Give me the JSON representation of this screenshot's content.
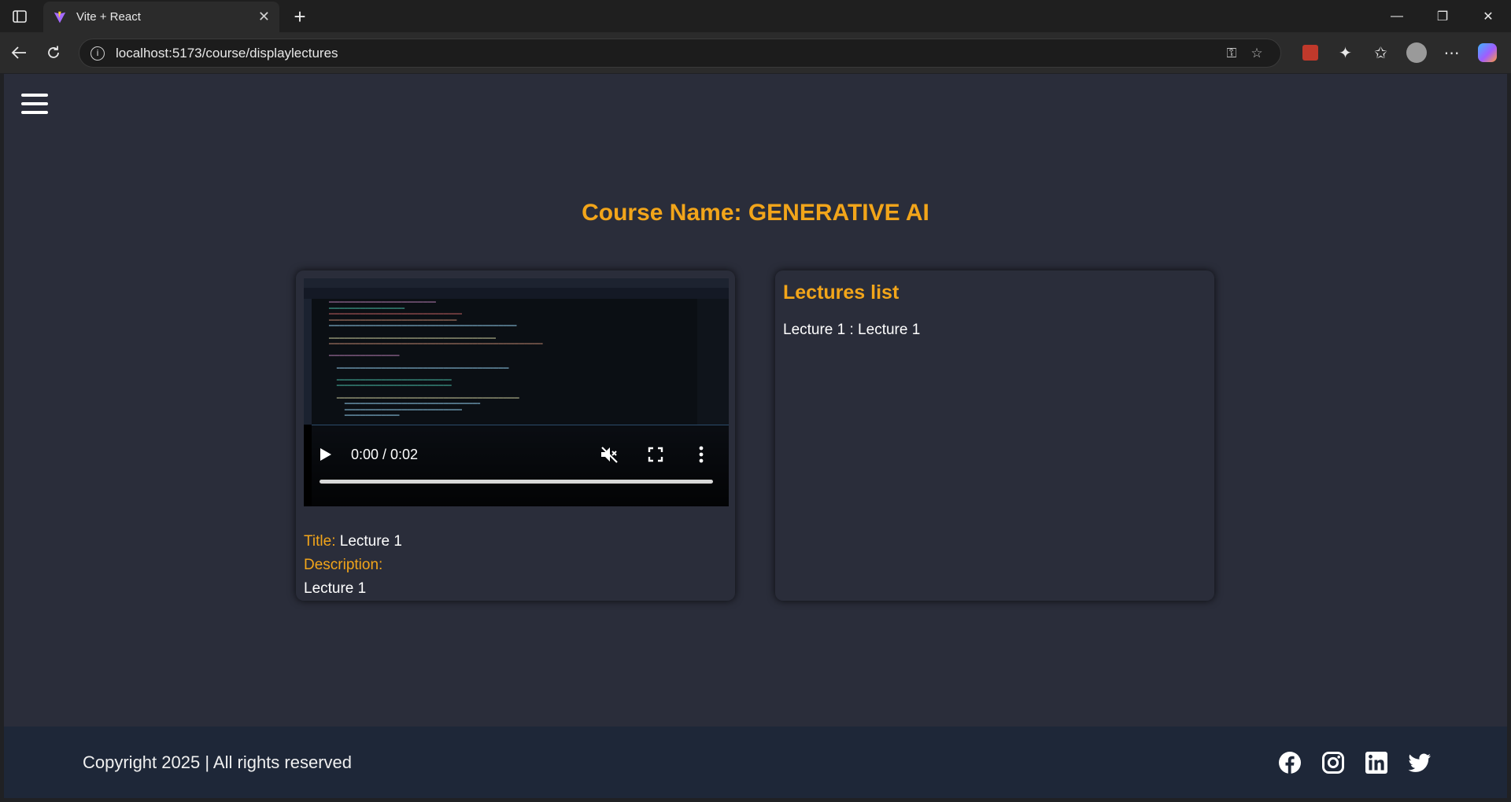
{
  "browser": {
    "tab_title": "Vite + React",
    "url": "localhost:5173/course/displaylectures"
  },
  "page": {
    "course_title": "Course Name: GENERATIVE AI",
    "video": {
      "time": "0:00 / 0:02"
    },
    "lecture": {
      "title_label": "Title:",
      "title_value": "Lecture 1",
      "description_label": "Description:",
      "description_value": "Lecture 1"
    },
    "lectures_list": {
      "heading": "Lectures list",
      "items": [
        "Lecture 1 : Lecture 1"
      ]
    },
    "footer": {
      "copyright": "Copyright 2025 | All rights reserved",
      "socials": [
        "facebook-icon",
        "instagram-icon",
        "linkedin-icon",
        "twitter-icon"
      ]
    }
  },
  "colors": {
    "accent": "#f2a51a",
    "page_bg": "#2a2d3a",
    "footer_bg": "#1e2738"
  }
}
